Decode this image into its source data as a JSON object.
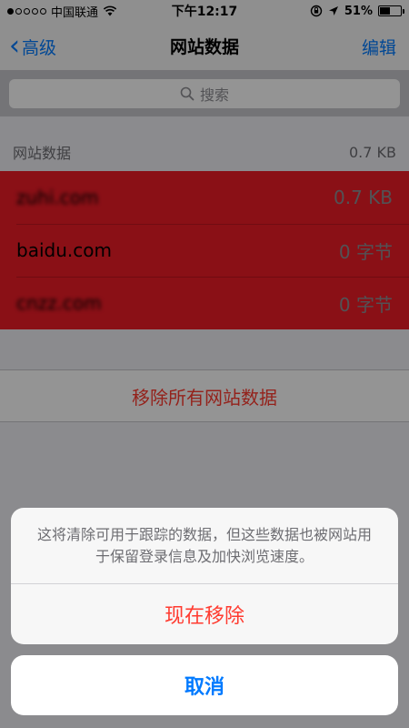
{
  "status_bar": {
    "carrier": "中国联通",
    "time": "下午12:17",
    "battery": "51%",
    "battery_level": 0.51
  },
  "nav": {
    "back_label": "高级",
    "title": "网站数据",
    "edit_label": "编辑"
  },
  "search": {
    "placeholder": "搜索"
  },
  "section": {
    "title": "网站数据",
    "total": "0.7 KB"
  },
  "sites": [
    {
      "name": "zuhi.com",
      "size": "0.7 KB"
    },
    {
      "name": "baidu.com",
      "size": "0 字节"
    },
    {
      "name": "cnzz.com",
      "size": "0 字节"
    }
  ],
  "remove_all_label": "移除所有网站数据",
  "action_sheet": {
    "message": "这将清除可用于跟踪的数据，但这些数据也被网站用于保留登录信息及加快浏览速度。",
    "confirm_label": "现在移除",
    "cancel_label": "取消"
  },
  "colors": {
    "accent": "#007aff",
    "destructive": "#ff3b30",
    "highlight": "#ee1c27"
  }
}
